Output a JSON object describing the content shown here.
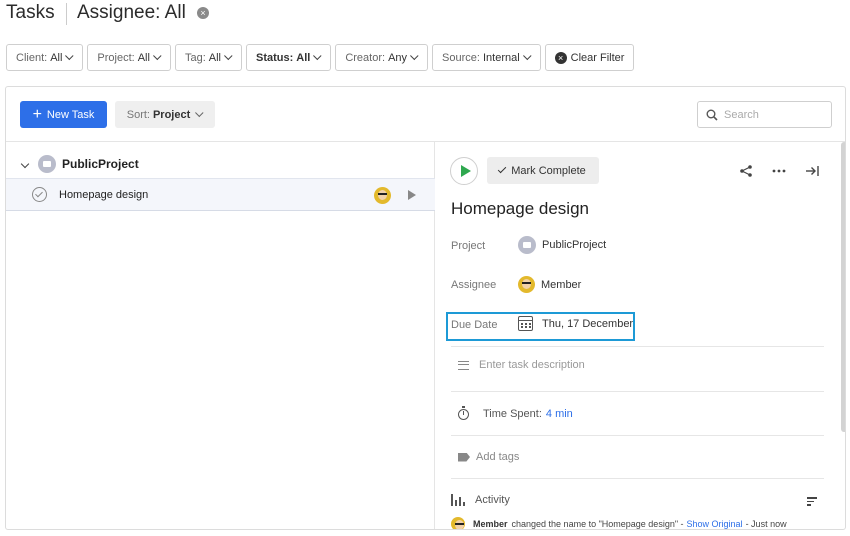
{
  "header": {
    "title": "Tasks",
    "assignee_filter": "Assignee: All",
    "clear_glyph": "×"
  },
  "filters": [
    {
      "label": "Client:",
      "value": "All"
    },
    {
      "label": "Project:",
      "value": "All"
    },
    {
      "label": "Tag:",
      "value": "All"
    },
    {
      "label": "Status:",
      "value": "All"
    },
    {
      "label": "Creator:",
      "value": "Any"
    },
    {
      "label": "Source:",
      "value": "Internal"
    }
  ],
  "clear_filter_label": "Clear Filter",
  "toolbar": {
    "new_task_label": "New Task",
    "sort_label": "Sort:",
    "sort_value": "Project",
    "search_placeholder": "Search"
  },
  "list": {
    "group_name": "PublicProject",
    "tasks": [
      {
        "name": "Homepage design"
      }
    ]
  },
  "detail": {
    "mark_complete_label": "Mark Complete",
    "title": "Homepage design",
    "project_label": "Project",
    "project_value": "PublicProject",
    "assignee_label": "Assignee",
    "assignee_value": "Member",
    "due_label": "Due Date",
    "due_value": "Thu, 17 December",
    "description_placeholder": "Enter task description",
    "time_label": "Time Spent:",
    "time_value": "4 min",
    "tags_placeholder": "Add tags",
    "activity_label": "Activity",
    "activity": [
      {
        "user": "Member",
        "text": "changed the name to \"Homepage design\" -",
        "link": "Show Original",
        "time": "- Just now"
      }
    ]
  },
  "colors": {
    "primary": "#2d6fe8",
    "play_green": "#2fa84f",
    "highlight": "#1d9ad6"
  }
}
